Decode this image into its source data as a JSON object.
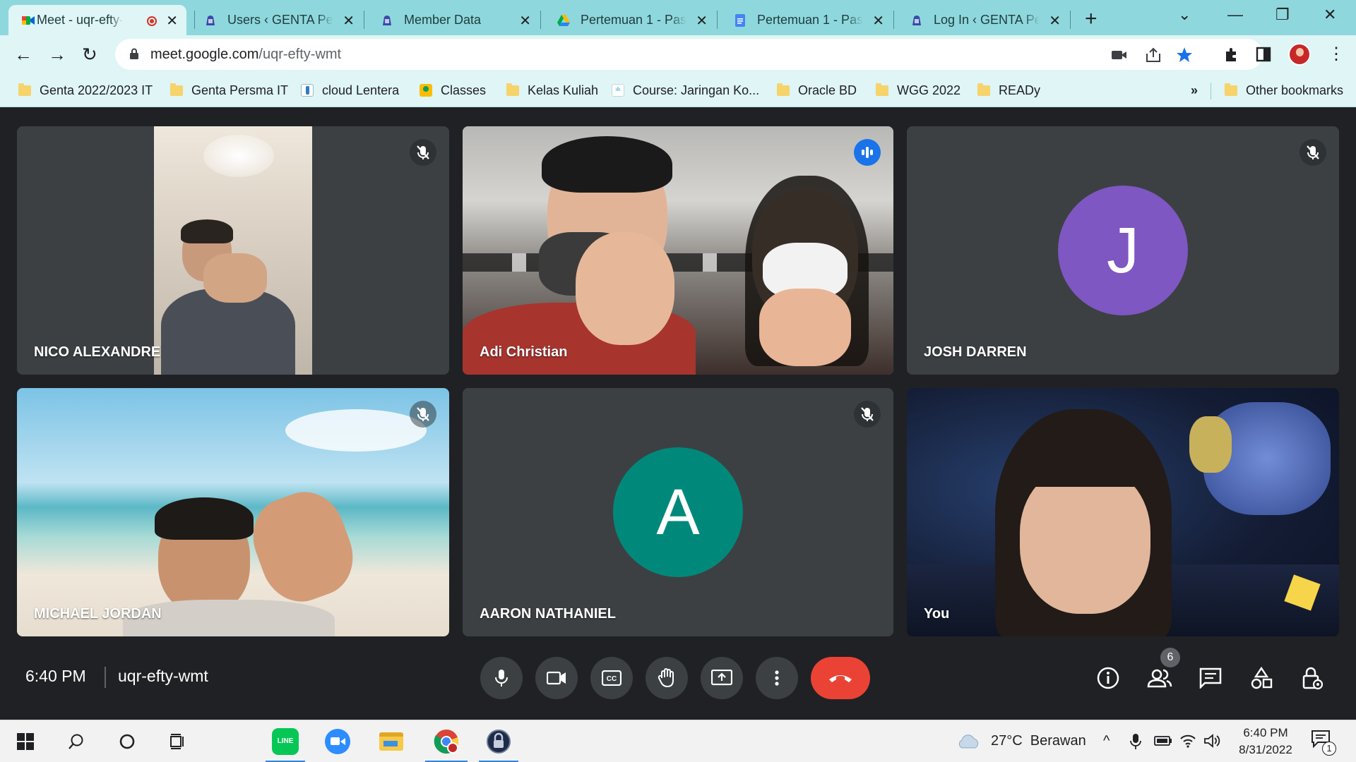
{
  "tabs": [
    {
      "title": "Meet - uqr-efty-wmt",
      "active": true,
      "icon": "google-meet-icon"
    },
    {
      "title": "Users ‹ GENTA Petra",
      "icon": "genta-icon"
    },
    {
      "title": "Member Data",
      "icon": "genta-icon"
    },
    {
      "title": "Pertemuan 1 - Passive",
      "icon": "google-drive-icon"
    },
    {
      "title": "Pertemuan 1 - Passive",
      "icon": "google-docs-icon"
    },
    {
      "title": "Log In ‹ GENTA Petra",
      "icon": "genta-icon"
    }
  ],
  "address": {
    "host": "meet.google.com",
    "path": "/uqr-efty-wmt"
  },
  "bookmarks": [
    {
      "label": "Genta 2022/2023 IT",
      "icon": "folder-icon"
    },
    {
      "label": "Genta Persma IT",
      "icon": "folder-icon"
    },
    {
      "label": "cloud Lentera",
      "icon": "lentera-icon"
    },
    {
      "label": "Classes",
      "icon": "classroom-icon"
    },
    {
      "label": "Kelas Kuliah",
      "icon": "folder-icon"
    },
    {
      "label": "Course: Jaringan Ko...",
      "icon": "cisco-icon"
    },
    {
      "label": "Oracle BD",
      "icon": "folder-icon"
    },
    {
      "label": "WGG 2022",
      "icon": "folder-icon"
    },
    {
      "label": "READy",
      "icon": "folder-icon"
    }
  ],
  "bookmarks_more": "»",
  "other_bookmarks": "Other bookmarks",
  "participants": [
    {
      "name": "NICO ALEXANDRE",
      "muted": true,
      "video": true
    },
    {
      "name": "Adi Christian",
      "muted": false,
      "speaking": true,
      "video": true
    },
    {
      "name": "JOSH DARREN",
      "muted": true,
      "video": false,
      "initial": "J",
      "avatar_color": "#7e57c2"
    },
    {
      "name": "MICHAEL JORDAN",
      "muted": true,
      "video": true
    },
    {
      "name": "AARON NATHANIEL",
      "muted": true,
      "video": false,
      "initial": "A",
      "avatar_color": "#00897b"
    },
    {
      "name": "You",
      "muted": false,
      "video": true
    }
  ],
  "meeting": {
    "time": "6:40 PM",
    "code": "uqr-efty-wmt",
    "participant_count": "6"
  },
  "colors": {
    "hangup": "#ea4335",
    "speaking_outline": "#8ab4f8",
    "chrome_frame": "#8ed8dd"
  },
  "taskbar": {
    "weather": "27°C  Berawan",
    "time": "6:40 PM",
    "date": "8/31/2022",
    "notification_count": "1"
  }
}
